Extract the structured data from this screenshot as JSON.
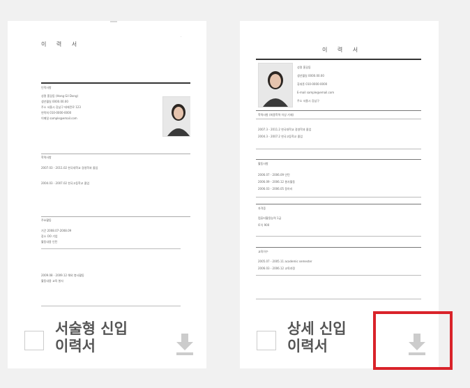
{
  "cards": [
    {
      "id": "narrative",
      "title": "서술형 신입\n이력서",
      "doc_title": "이 력 서",
      "lines": [
        "인적사항",
        "성명 홍길동 (Hong Gil Dong)",
        "생년월일 0000.00.00",
        "주소 서울시 강남구 테헤란로 123",
        "연락처 010-0000-0000",
        "이메일 sample@email.com",
        "학력사항",
        "2007.03 - 2011.02 한국대학교 경영학과 졸업",
        "2004.03 - 2007.02 한국고등학교 졸업",
        "주요활동",
        "기간 2008.07-2008.09",
        "장소 OO 기업",
        "활동내용 인턴",
        "2009.08 - 2009.12 해외 봉사활동",
        "활동내용 교육 봉사"
      ]
    },
    {
      "id": "detailed",
      "title": "상세 신입\n이력서",
      "doc_title": "이 력 서",
      "lines": [
        "성명 홍길동",
        "생년월일 0000.00.00",
        "휴대폰 010-0000-0000",
        "E-mail sample@email.com",
        "주소 서울시 강남구",
        "학력사항 (최종학력 이상 기재)",
        "2007.3 - 2011.2 한국대학교 경영학과 졸업",
        "2004.3 - 2007.2 한국고등학교 졸업",
        "활동사항",
        "2006.07 - 2006.09 인턴",
        "2006.09 - 2006.12 봉사활동",
        "2006.03 - 2006.05 동아리",
        "자격증",
        "컴퓨터활용능력 1급",
        "토익 900",
        "교육이수",
        "2005.07 - 2005.11 academic semester",
        "2006.03 - 2006.12 교육과정"
      ]
    }
  ],
  "icons": {
    "checkbox": "checkbox-empty",
    "download": "download-arrow-icon"
  },
  "colors": {
    "highlight": "#d9232a",
    "title": "#555555",
    "icon": "#cccccc"
  }
}
